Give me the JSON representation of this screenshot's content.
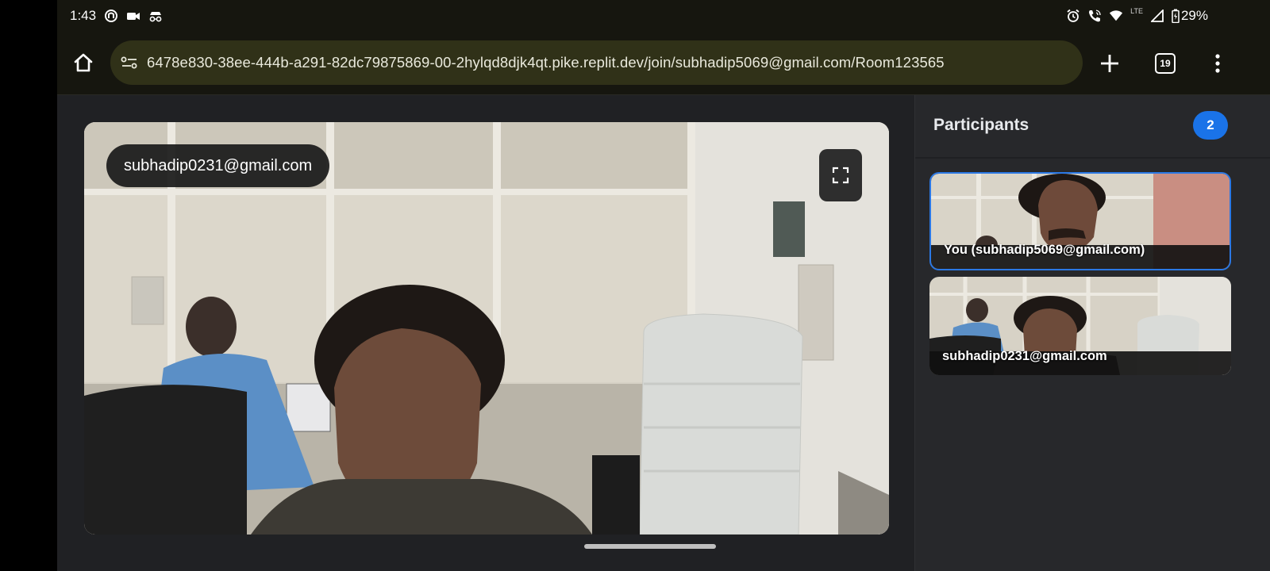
{
  "status_bar": {
    "time": "1:43",
    "left_icons": [
      "sync-icon",
      "video-camera-icon",
      "incognito-icon"
    ],
    "right_icons": [
      "alarm-icon",
      "wifi-calling-icon",
      "wifi-icon",
      "cell-signal-icon",
      "battery-icon"
    ],
    "network_label": "LTE",
    "battery": "29%"
  },
  "browser": {
    "url": "6478e830-38ee-444b-a291-82dc79875869-00-2hylqd8djk4qt.pike.replit.dev/join/subhadip5069@gmail.com/Room123565",
    "tab_count": "19"
  },
  "main_video": {
    "participant": "subhadip0231@gmail.com"
  },
  "participants_panel": {
    "title": "Participants",
    "count": "2",
    "items": [
      {
        "label": "You (subhadip5069@gmail.com)",
        "active": true
      },
      {
        "label": "subhadip0231@gmail.com",
        "active": false
      }
    ]
  },
  "colors": {
    "accent": "#1a73e8",
    "panel_bg": "#27282b",
    "page_bg": "#202124",
    "toolbar_bg": "#16160f",
    "urlbar_bg": "#303118"
  }
}
